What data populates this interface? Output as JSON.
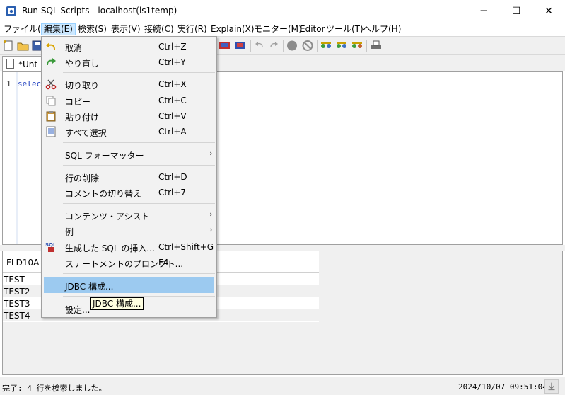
{
  "window": {
    "title": "Run SQL Scripts - localhost(ls1temp)",
    "minimize_glyph": "─",
    "maximize_glyph": "☐",
    "close_glyph": "✕"
  },
  "menubar": {
    "items": [
      {
        "label": "ファイル(F)"
      },
      {
        "label": "編集(E)"
      },
      {
        "label": "検索(S)"
      },
      {
        "label": "表示(V)"
      },
      {
        "label": "接続(C)"
      },
      {
        "label": "実行(R)"
      },
      {
        "label": "Explain(X)"
      },
      {
        "label": "モニター(M)"
      },
      {
        "label": "Editor"
      },
      {
        "label": "ツール(T)"
      },
      {
        "label": "ヘルプ(H)"
      }
    ]
  },
  "editor": {
    "tab_label": "*Unt i",
    "line_number": "1",
    "code": "select"
  },
  "edit_menu": {
    "items": [
      {
        "icon": "undo-icon",
        "label": "取消",
        "shortcut": "Ctrl+Z"
      },
      {
        "icon": "redo-icon",
        "label": "やり直し",
        "shortcut": "Ctrl+Y"
      },
      {
        "icon": "cut-icon",
        "label": "切り取り",
        "shortcut": "Ctrl+X"
      },
      {
        "icon": "copy-icon",
        "label": "コピー",
        "shortcut": "Ctrl+C"
      },
      {
        "icon": "paste-icon",
        "label": "貼り付け",
        "shortcut": "Ctrl+V"
      },
      {
        "icon": "select-all-icon",
        "label": "すべて選択",
        "shortcut": "Ctrl+A"
      },
      {
        "label": "SQL フォーマッター",
        "submenu": true
      },
      {
        "label": "行の削除",
        "shortcut": "Ctrl+D"
      },
      {
        "label": "コメントの切り替え",
        "shortcut": "Ctrl+7"
      },
      {
        "label": "コンテンツ・アシスト",
        "submenu": true
      },
      {
        "label": "例",
        "submenu": true
      },
      {
        "icon": "sql-insert-icon",
        "icon_text": "SQL",
        "label": "生成した SQL の挿入...",
        "shortcut": "Ctrl+Shift+G"
      },
      {
        "label": "ステートメントのプロンプト...",
        "shortcut": "F4"
      },
      {
        "label": "JDBC 構成..."
      },
      {
        "label": "設定..."
      }
    ],
    "submenu_arrow": "›"
  },
  "tooltip": {
    "text": "JDBC 構成..."
  },
  "results": {
    "column_header": "FLD10A",
    "rows": [
      "TEST",
      "TEST2",
      "TEST3",
      "TEST4"
    ]
  },
  "status": {
    "message": "完了: 4 行を検索しました。",
    "timestamp": "2024/10/07 09:51:04"
  },
  "colors": {
    "menu_highlight": "#9ccaf0",
    "active_menu": "#cce8ff",
    "code_blue": "#1f3fbf"
  }
}
